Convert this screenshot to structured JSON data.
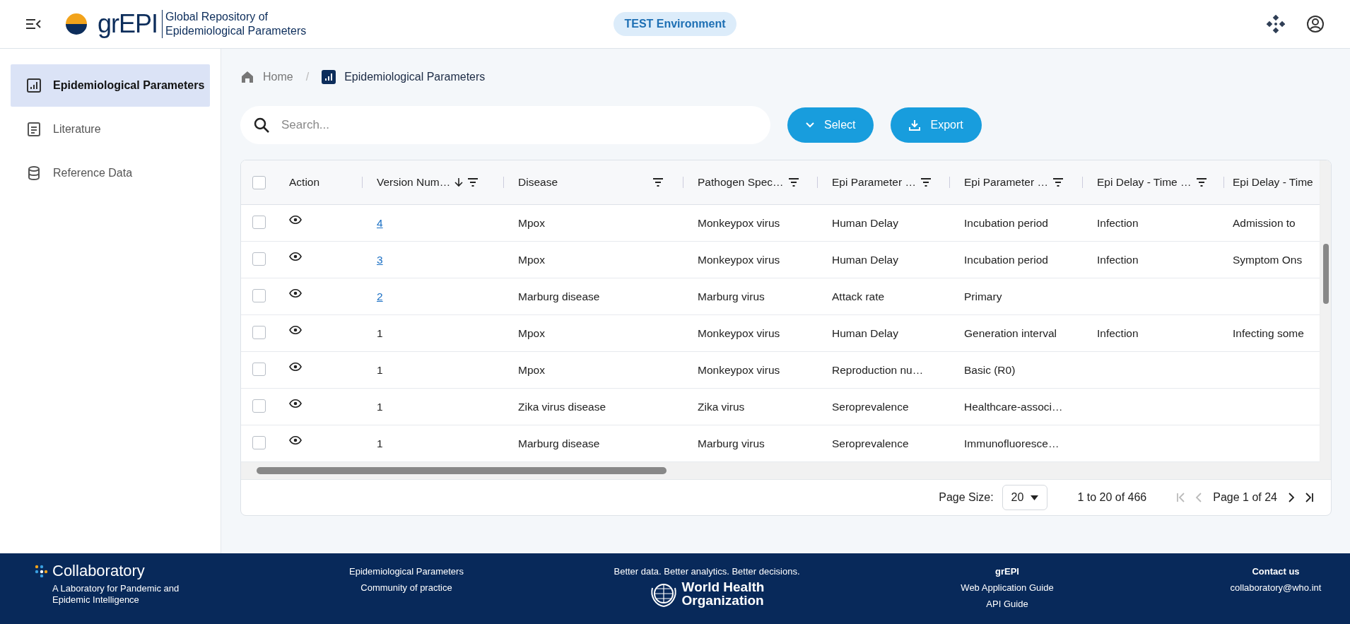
{
  "header": {
    "logo_text": "grEPI",
    "title_lines": [
      "Global Repository of",
      "Epidemiological Parameters"
    ],
    "environment_badge": "TEST Environment"
  },
  "sidebar": {
    "items": [
      {
        "label": "Epidemiological Parameters",
        "selected": true
      },
      {
        "label": "Literature",
        "selected": false
      },
      {
        "label": "Reference Data",
        "selected": false
      }
    ]
  },
  "breadcrumb": {
    "separator": "/",
    "items": [
      "Home",
      "Epidemiological Parameters"
    ]
  },
  "search": {
    "placeholder": "Search..."
  },
  "buttons": [
    "Select",
    "Export"
  ],
  "table": {
    "all_checked": false,
    "columns": [
      {
        "label": "Action",
        "sorted": false,
        "filter": false
      },
      {
        "label": "Version Num…",
        "sorted": true,
        "filter": true
      },
      {
        "label": "Disease",
        "sorted": false,
        "filter": true
      },
      {
        "label": "Pathogen Spec…",
        "sorted": false,
        "filter": true
      },
      {
        "label": "Epi Parameter …",
        "sorted": false,
        "filter": true
      },
      {
        "label": "Epi Parameter …",
        "sorted": false,
        "filter": true
      },
      {
        "label": "Epi Delay - Time …",
        "sorted": false,
        "filter": true
      },
      {
        "label": "Epi Delay - Time",
        "sorted": false,
        "filter": false
      }
    ],
    "rows": [
      {
        "checked": false,
        "version_linked": true,
        "cells": [
          "",
          "4",
          "Mpox",
          "Monkeypox virus",
          "Human Delay",
          "Incubation period",
          "Infection",
          "Admission to"
        ]
      },
      {
        "checked": false,
        "version_linked": true,
        "cells": [
          "",
          "3",
          "Mpox",
          "Monkeypox virus",
          "Human Delay",
          "Incubation period",
          "Infection",
          "Symptom Ons"
        ]
      },
      {
        "checked": false,
        "version_linked": true,
        "cells": [
          "",
          "2",
          "Marburg disease",
          "Marburg virus",
          "Attack rate",
          "Primary",
          "",
          ""
        ]
      },
      {
        "checked": false,
        "version_linked": false,
        "cells": [
          "",
          "1",
          "Mpox",
          "Monkeypox virus",
          "Human Delay",
          "Generation interval",
          "Infection",
          "Infecting some"
        ]
      },
      {
        "checked": false,
        "version_linked": false,
        "cells": [
          "",
          "1",
          "Mpox",
          "Monkeypox virus",
          "Reproduction nu…",
          "Basic (R0)",
          "",
          ""
        ]
      },
      {
        "checked": false,
        "version_linked": false,
        "cells": [
          "",
          "1",
          "Zika virus disease",
          "Zika virus",
          "Seroprevalence",
          "Healthcare-associ…",
          "",
          ""
        ]
      },
      {
        "checked": false,
        "version_linked": false,
        "cells": [
          "",
          "1",
          "Marburg disease",
          "Marburg virus",
          "Seroprevalence",
          "Immunofluoresce…",
          "",
          ""
        ]
      }
    ]
  },
  "pagination": {
    "page_size_label": "Page Size:",
    "page_size": "20",
    "range": "1 to 20 of 466",
    "page": "Page 1 of 24",
    "first_disabled": true,
    "prev_disabled": true,
    "next_disabled": false,
    "last_disabled": false
  },
  "footer": {
    "brand": "Collaboratory",
    "tagline": "A Laboratory for Pandemic and Epidemic Intelligence",
    "links": [
      "Epidemiological Parameters",
      "Community of practice"
    ],
    "slogan": "Better data. Better analytics. Better decisions.",
    "who_lines": [
      "World Health",
      "Organization"
    ],
    "guide_title": "grEPI",
    "guides": [
      "Web Application Guide",
      "API Guide"
    ],
    "contact_title": "Contact us",
    "contact_email": "collaboratory@who.int"
  }
}
